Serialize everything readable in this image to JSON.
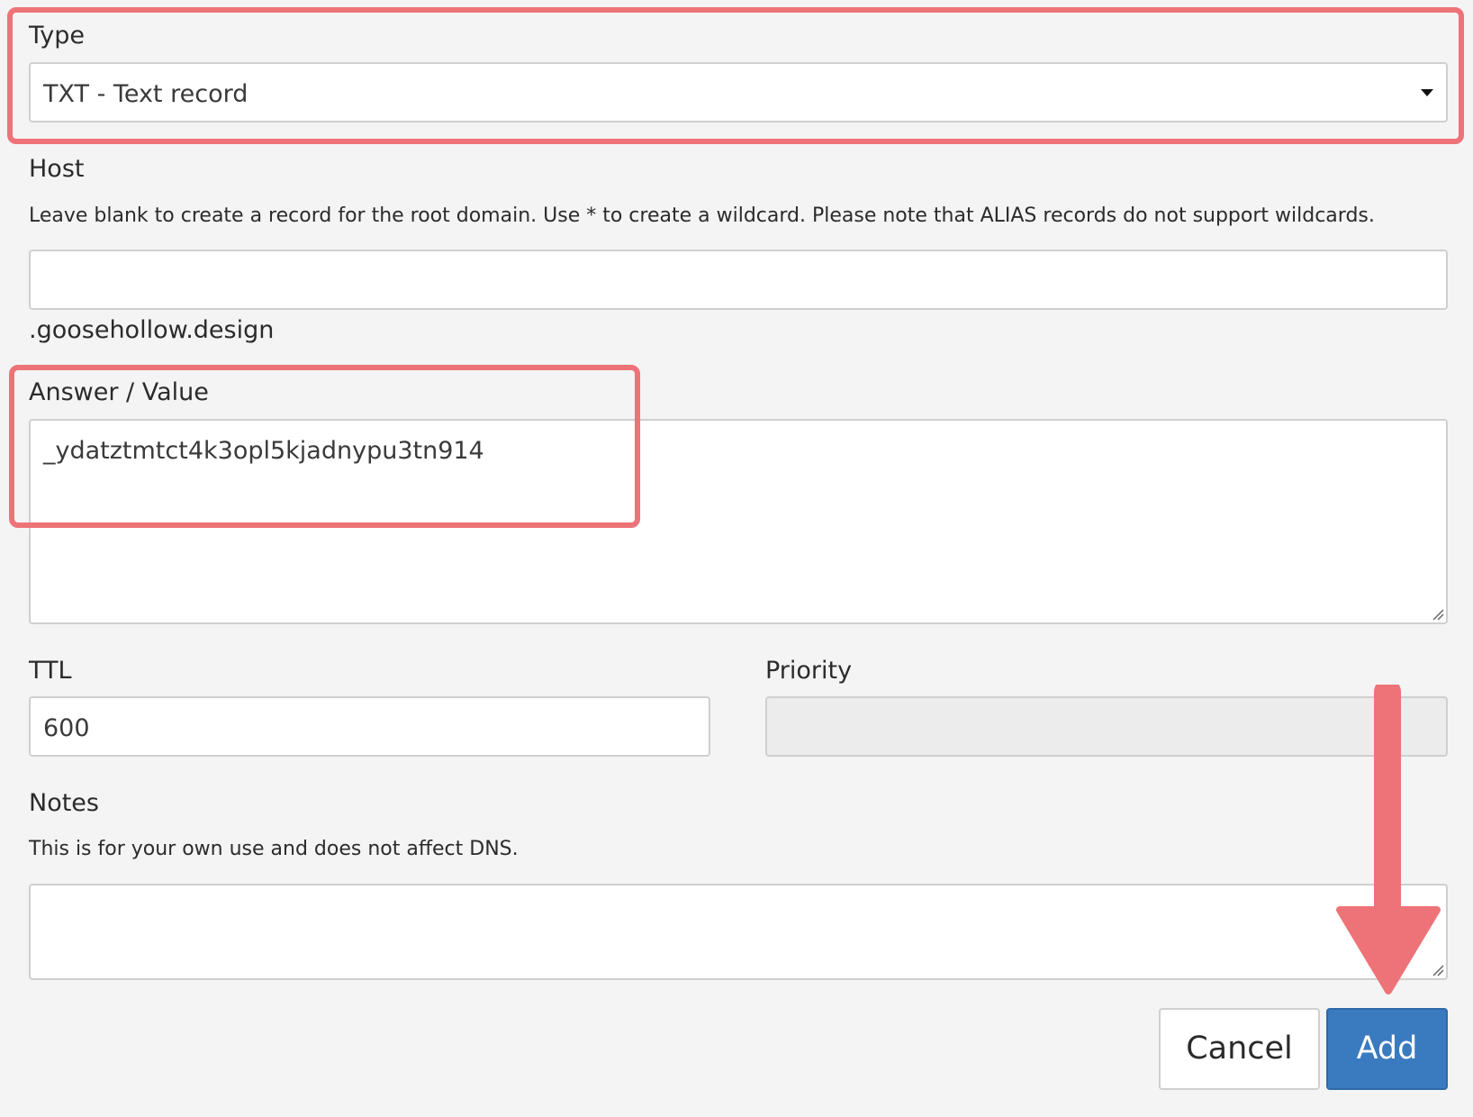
{
  "type_field": {
    "label": "Type",
    "selected": "TXT - Text record"
  },
  "host_field": {
    "label": "Host",
    "help": "Leave blank to create a record for the root domain. Use * to create a wildcard. Please note that ALIAS records do not support wildcards.",
    "value": "",
    "suffix": ".goosehollow.design"
  },
  "answer_field": {
    "label": "Answer / Value",
    "value": "_ydatztmtct4k3opl5kjadnypu3tn914"
  },
  "ttl_field": {
    "label": "TTL",
    "value": "600"
  },
  "priority_field": {
    "label": "Priority",
    "value": ""
  },
  "notes_field": {
    "label": "Notes",
    "help": "This is for your own use and does not affect DNS.",
    "value": ""
  },
  "buttons": {
    "cancel": "Cancel",
    "add": "Add"
  },
  "colors": {
    "highlight": "#ee7378",
    "primary_button": "#3a7bc0",
    "background": "#f4f4f4"
  }
}
